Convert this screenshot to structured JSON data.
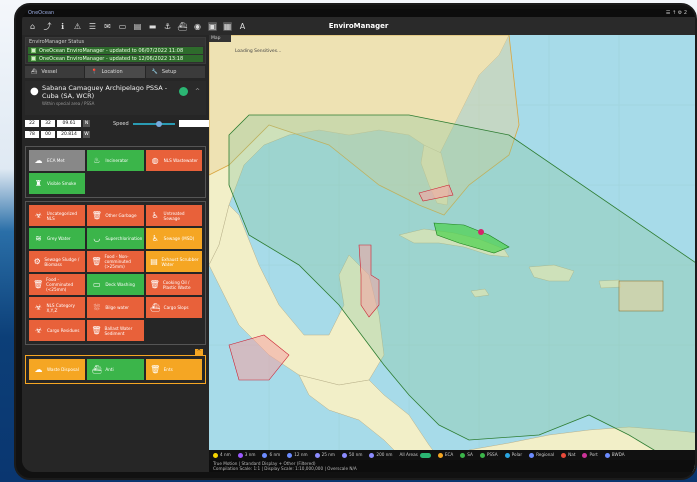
{
  "topbar": {
    "app_name": "OneOcean",
    "right_text": "☰ ↑ ⚙ 2"
  },
  "app_title": "EnviroManager",
  "toolbar_icons": [
    "home-icon",
    "route-icon",
    "info-icon",
    "warning-icon",
    "list-icon",
    "message-icon",
    "package-icon",
    "document-icon",
    "laptop-icon",
    "anchor-icon",
    "ship-icon",
    "camera-icon",
    "record-icon",
    "map-icon",
    "text-icon"
  ],
  "status": {
    "header": "EnviroManager Status",
    "rows": [
      "OneOcean EnviroManager - updated to 06/07/2022 11:08",
      "OneOcean EnviroManager - updated to 12/06/2022 13:18"
    ]
  },
  "tabs": [
    {
      "label": "Vessel",
      "icon": "ship-icon"
    },
    {
      "label": "Location",
      "icon": "location-pin-icon"
    },
    {
      "label": "Setup",
      "icon": "wrench-icon"
    }
  ],
  "location": {
    "name": "Sabana Camaguey Archipelago PSSA - Cuba (SA, WCR)",
    "subtitle": "Within special area / PSSA"
  },
  "coords": {
    "lat_deg": "22",
    "lat_min": "32",
    "lat_sec": "09.61",
    "lat_hem": "N",
    "lon_deg": "78",
    "lon_min": "00",
    "lon_sec": "20.814",
    "lon_hem": "W",
    "speed_label": "Speed",
    "speed_value": "8.0 kn",
    "speed_fraction": 0.62
  },
  "panel1": [
    {
      "label": "ECA Met",
      "color": "#888888",
      "icon": "cloud-icon"
    },
    {
      "label": "Incinerator",
      "color": "#3bb54a",
      "icon": "flame-icon"
    },
    {
      "label": "NLS Wastewater",
      "color": "#e8613a",
      "icon": "drop-icon"
    },
    {
      "label": "Visible Smoke",
      "color": "#3bb54a",
      "icon": "chimney-icon"
    }
  ],
  "panel2": [
    {
      "label": "Uncategorized NLS",
      "color": "#e8613a",
      "icon": "hazard-icon"
    },
    {
      "label": "Other Garbage",
      "color": "#e8613a",
      "icon": "bin-icon"
    },
    {
      "label": "Untreated Sewage",
      "color": "#e8613a",
      "icon": "toilet-icon"
    },
    {
      "label": "Grey Water",
      "color": "#3bb54a",
      "icon": "pipe-icon"
    },
    {
      "label": "Superchlorination",
      "color": "#3bb54a",
      "icon": "tub-icon"
    },
    {
      "label": "Sewage (MSD)",
      "color": "#f5a623",
      "icon": "toilet-icon"
    },
    {
      "label": "Sewage Sludge / Biomass",
      "color": "#e8613a",
      "icon": "sludge-icon"
    },
    {
      "label": "Food - Non-comminuted (>25mm)",
      "color": "#e8613a",
      "icon": "bin-icon"
    },
    {
      "label": "Exhaust Scrubber Water",
      "color": "#f5a623",
      "icon": "scrubber-icon"
    },
    {
      "label": "Food - Comminuted (<25mm)",
      "color": "#e8613a",
      "icon": "bin-icon"
    },
    {
      "label": "Deck Washing",
      "color": "#3bb54a",
      "icon": "deck-icon"
    },
    {
      "label": "Cooking Oil / Plastic Waste",
      "color": "#e8613a",
      "icon": "bin-icon"
    },
    {
      "label": "NLS Category X,Y,Z",
      "color": "#e8613a",
      "icon": "hazard-icon"
    },
    {
      "label": "Bilge water",
      "color": "#e8613a",
      "icon": "bilge-icon"
    },
    {
      "label": "Cargo Slops",
      "color": "#e8613a",
      "icon": "ship-icon"
    },
    {
      "label": "Cargo Residues",
      "color": "#e8613a",
      "icon": "hazard-icon"
    },
    {
      "label": "Ballast Water Sediment",
      "color": "#e8613a",
      "icon": "bin-icon"
    }
  ],
  "panel3": [
    {
      "label": "Waste Disposal",
      "color": "#f5a623",
      "icon": "cloud-icon"
    },
    {
      "label": "Anti",
      "color": "#3bb54a",
      "icon": "ship-icon"
    },
    {
      "label": "Ents",
      "color": "#f5a623",
      "icon": "bin-icon"
    }
  ],
  "map": {
    "tab_label": "Map",
    "loading": "Loading Sensitives...",
    "legend": [
      {
        "label": "4 nm",
        "color": "#f5d400"
      },
      {
        "label": "3 nm",
        "color": "#9b59ff"
      },
      {
        "label": "6 nm",
        "color": "#6c8cff"
      },
      {
        "label": "12 nm",
        "color": "#6c8cff"
      },
      {
        "label": "25 nm",
        "color": "#8c8cff"
      },
      {
        "label": "50 nm",
        "color": "#8c8cff"
      },
      {
        "label": "200 nm",
        "color": "#8c8cff"
      },
      {
        "label": "All Areas",
        "color": ""
      },
      {
        "label": "ECA",
        "color": "#f5a623"
      },
      {
        "label": "SA",
        "color": "#3bb54a"
      },
      {
        "label": "PSSA",
        "color": "#3bb54a"
      },
      {
        "label": "Polar",
        "color": "#2aa5e0"
      },
      {
        "label": "Regional",
        "color": "#6c8cff"
      },
      {
        "label": "Nat",
        "color": "#e84a3a"
      },
      {
        "label": "Port",
        "color": "#cc3399"
      },
      {
        "label": "BWDA",
        "color": "#6c8cff"
      }
    ],
    "info_line1": "True Motion | Standard Display + Other (Filtered)",
    "info_line2": "Compilation Scale: 1:1 | Display Scale: 1:10,000,000 | Overscale N/A"
  }
}
